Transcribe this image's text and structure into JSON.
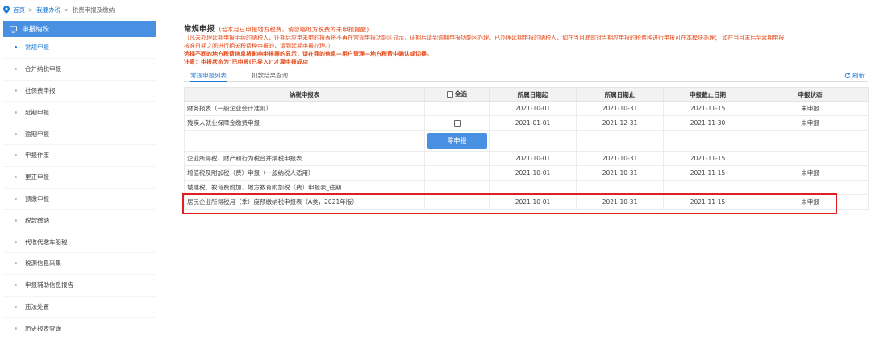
{
  "breadcrumb": {
    "home": "首页",
    "sep1": ">",
    "level2": "我要办税",
    "sep2": ">",
    "current": "税费申报及缴纳"
  },
  "sidebar": {
    "header": "申报纳税",
    "items": [
      {
        "label": "常规申报"
      },
      {
        "label": "合并纳税申报"
      },
      {
        "label": "社保费申报"
      },
      {
        "label": "延期申报"
      },
      {
        "label": "逾期申报"
      },
      {
        "label": "申报作废"
      },
      {
        "label": "更正申报"
      },
      {
        "label": "预缴申报"
      },
      {
        "label": "税款缴纳"
      },
      {
        "label": "代收代缴车船税"
      },
      {
        "label": "税源信息采集"
      },
      {
        "label": "申报辅助信息报告"
      },
      {
        "label": "违法处置"
      },
      {
        "label": "历史报表查询"
      }
    ]
  },
  "main": {
    "title": "常规申报",
    "title_note": "(若本月已申报地方税费，请忽略地方税费的未申报提醒)",
    "notice_lines": [
      "（凡未办理延期申报手续的纳税人，征期后应申未申的报表将不再在常规申报功能区显示，征期后请到逾期申报功能区办理。已办理延期申报的纳税人，如在当月底前对当期应申报的税费种进行申报可在本模块办理； 如在当月末后至延期申报",
      "核准日期之间进行相关税费种申报的，请到延期申报办理。）",
      "选择不同的地方税费信息将影响申报表的显示，请在我的信息—用户管理—地方税费中确认或切换。",
      "注意：申报状态为\"已申报(已导入)\"才算申报成功"
    ],
    "tabs": [
      "常规申报列表",
      "扣款结果查询"
    ],
    "refresh": "刷新"
  },
  "table": {
    "headers": {
      "name": "纳税申报表",
      "select_all": "全选",
      "start": "所属日期起",
      "end": "所属日期止",
      "deadline": "申报截止日期",
      "status": "申报状态"
    },
    "zero_button": "零申报",
    "rows": [
      {
        "name": "财务报表（一般企业会计准则）",
        "start": "2021-10-01",
        "end": "2021-10-31",
        "deadline": "2021-11-15",
        "status": "未申报"
      },
      {
        "name": "残疾人就业保障金缴费申报",
        "start": "2021-01-01",
        "end": "2021-12-31",
        "deadline": "2021-11-30",
        "status": "未申报"
      },
      {
        "name": "企业所得税、财产和行为税合并纳税申报表",
        "start": "2021-10-01",
        "end": "2021-10-31",
        "deadline": "2021-11-15",
        "status": ""
      },
      {
        "name": "增值税及附加税（费）申报（一般纳税人适用）",
        "start": "2021-10-01",
        "end": "2021-10-31",
        "deadline": "2021-11-15",
        "status": "未申报"
      },
      {
        "name": "城建税、教育费附加、地方教育附加税（费）申报表_往期",
        "start": "",
        "end": "",
        "deadline": "",
        "status": ""
      },
      {
        "name": "居民企业所得税月（季）度预缴纳税申报表（A类，2021年版）",
        "start": "2021-10-01",
        "end": "2021-10-31",
        "deadline": "2021-11-15",
        "status": "未申报"
      }
    ]
  },
  "colors": {
    "accent": "#4a90e2",
    "link": "#1f79d6",
    "notice": "#e64a19",
    "highlight": "#e02020"
  }
}
